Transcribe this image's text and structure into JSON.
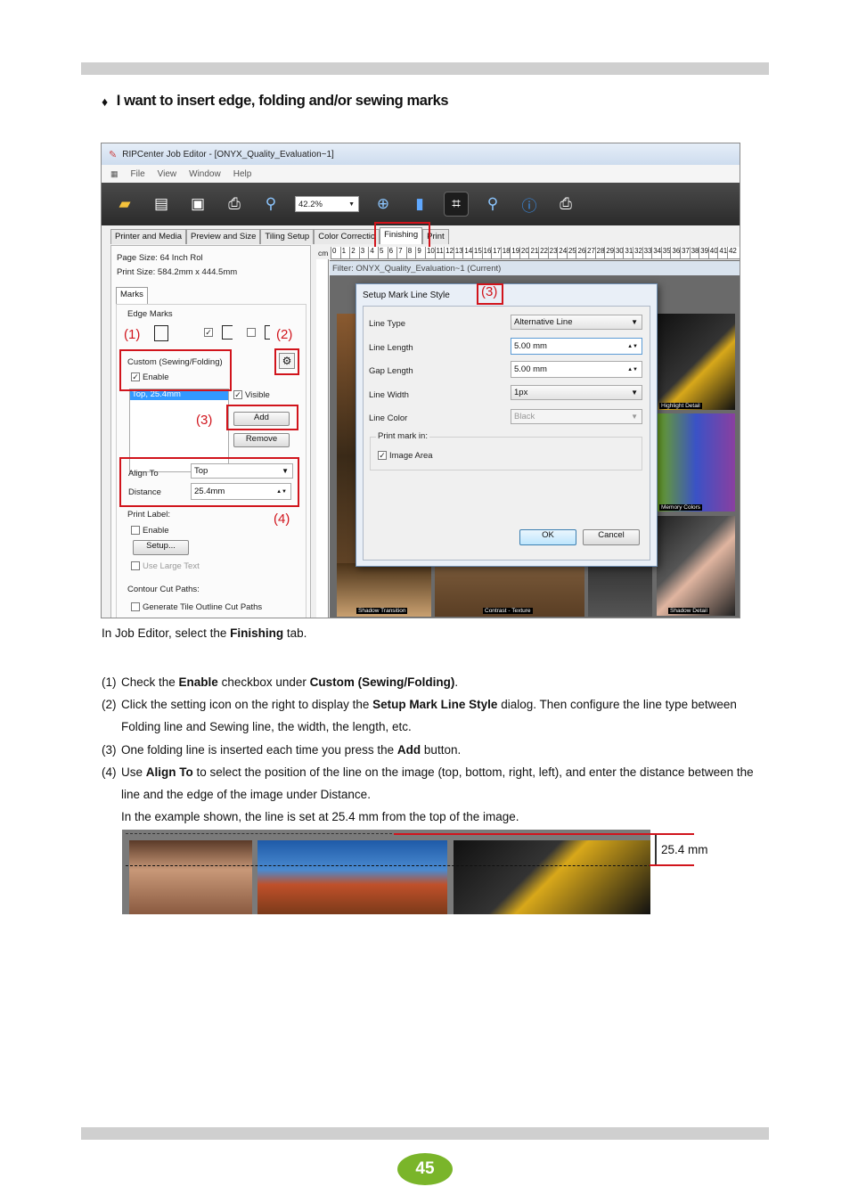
{
  "heading": {
    "bullet": "♦",
    "text": "I want to insert edge, folding and/or sewing marks"
  },
  "app": {
    "title": "RIPCenter Job Editor - [ONYX_Quality_Evaluation~1]",
    "menu": [
      "File",
      "View",
      "Window",
      "Help"
    ],
    "zoom": "42.2%",
    "tabs": [
      "Printer and Media",
      "Preview and Size",
      "Tiling Setup",
      "Color Correctio",
      "Finishing",
      "Print"
    ],
    "page_size": "Page Size: 64 Inch Rol",
    "print_size": "Print Size: 584.2mm x 444.5mm",
    "panel_tab": "Marks",
    "edge_marks": "Edge Marks",
    "custom_group": "Custom (Sewing/Folding)",
    "enable": "Enable",
    "list_item": "Top, 25.4mm",
    "visible": "Visible",
    "add": "Add",
    "remove": "Remove",
    "align_to_label": "Align To",
    "align_to_value": "Top",
    "distance_label": "Distance",
    "distance_value": "25.4mm",
    "print_label": "Print Label:",
    "print_label_enable": "Enable",
    "setup_btn": "Setup...",
    "use_large_text": "Use Large Text",
    "contour": "Contour Cut Paths:",
    "generate_tile": "Generate Tile Outline Cut Paths",
    "ruler_unit": "cm",
    "filter": "Filter: ONYX_Quality_Evaluation~1 (Current)",
    "photo_labels": [
      "Shadow Transition",
      "Contrast - Texture",
      "Shadow Detail",
      "Memory Colors",
      "Highlight Detail"
    ]
  },
  "dialog": {
    "title": "Setup Mark Line Style",
    "line_type_label": "Line Type",
    "line_type_value": "Alternative Line",
    "line_length_label": "Line Length",
    "line_length_value": "5.00 mm",
    "gap_length_label": "Gap Length",
    "gap_length_value": "5.00 mm",
    "line_width_label": "Line Width",
    "line_width_value": "1px",
    "line_color_label": "Line Color",
    "line_color_value": "Black",
    "print_mark_in": "Print mark in:",
    "image_area": "Image Area",
    "ok": "OK",
    "cancel": "Cancel"
  },
  "callouts": {
    "c1": "(1)",
    "c2": "(2)",
    "c3": "(3)",
    "c3b": "(3)",
    "c4": "(4)"
  },
  "caption": {
    "before": "In Job Editor, select the ",
    "bold": "Finishing",
    "after": " tab."
  },
  "steps": [
    {
      "num": "(1)",
      "t1": "Check the ",
      "b1": "Enable",
      "t2": " checkbox under ",
      "b2": "Custom (Sewing/Folding)",
      "t3": "."
    },
    {
      "num": "(2)",
      "t1": "Click the setting icon on the right to display the ",
      "b1": "Setup Mark Line Style",
      "t2": " dialog. Then configure the line type between Folding line and Sewing line, the width, the length, etc."
    },
    {
      "num": "(3)",
      "t1": "One folding line is inserted each time you press the ",
      "b1": "Add",
      "t2": " button."
    },
    {
      "num": "(4)",
      "t1": "Use ",
      "b1": "Align To",
      "t2": " to select the position of the line on the image (top, bottom, right, left), and enter the distance between the line and the edge of the image under Distance."
    }
  ],
  "example": "In the example shown, the line is set at 25.4 mm from the top of the image.",
  "measure": "25.4 mm",
  "page_number": "45",
  "colors": {
    "callout_red": "#d1141c",
    "page_badge": "#7ab52a",
    "bar_gray": "#cfcfcf"
  }
}
